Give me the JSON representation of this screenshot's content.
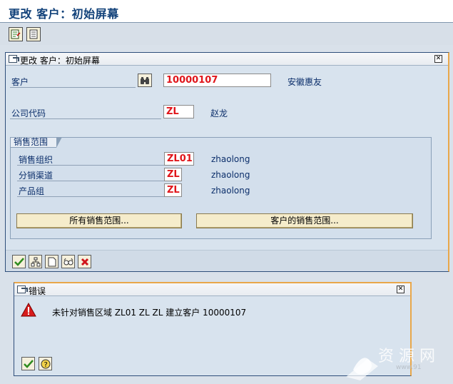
{
  "page": {
    "title": "更改 客户：初始屏幕"
  },
  "toolbar": {
    "icons": [
      "document-edit-icon",
      "document-icon"
    ]
  },
  "main_dialog": {
    "title": "更改 客户：初始屏幕",
    "fields": {
      "customer": {
        "label": "客户",
        "value": "10000107",
        "description": "安徽惠友"
      },
      "company_code": {
        "label": "公司代码",
        "value": "ZL",
        "description": "赵龙"
      }
    },
    "sales_area": {
      "title": "销售范围",
      "rows": [
        {
          "label": "销售组织",
          "value": "ZL01",
          "description": "zhaolong"
        },
        {
          "label": "分销渠道",
          "value": "ZL",
          "description": "zhaolong"
        },
        {
          "label": "产品组",
          "value": "ZL",
          "description": "zhaolong"
        }
      ],
      "buttons": {
        "all_sales_areas": "所有销售范围...",
        "customer_sales_areas": "客户的销售范围..."
      }
    },
    "action_icons": [
      "check-icon",
      "org-structure-icon",
      "new-document-icon",
      "glasses-icon",
      "cancel-icon"
    ]
  },
  "error_dialog": {
    "title": "错误",
    "message": "未针对销售区域 ZL01 ZL ZL 建立客户 10000107",
    "action_icons": [
      "check-icon",
      "help-icon"
    ]
  },
  "watermark": {
    "url": "www.91"
  },
  "colors": {
    "title_blue": "#12427a",
    "value_red": "#e0161b",
    "label_blue": "#0c2f6b",
    "dialog_border": "#2e4e7a",
    "accent_orange": "#e9a74a"
  }
}
